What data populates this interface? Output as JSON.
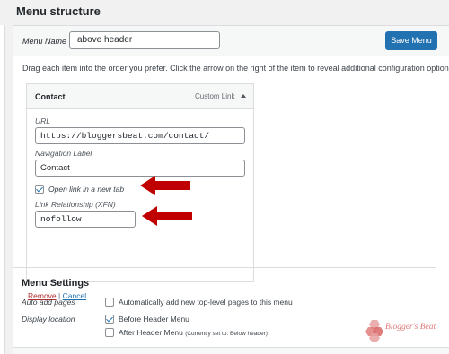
{
  "page": {
    "title": "Menu structure"
  },
  "header": {
    "menu_name_label": "Menu Name",
    "menu_name_value": "above header",
    "save_button": "Save Menu"
  },
  "instructions": "Drag each item into the order you prefer. Click the arrow on the right of the item to reveal additional configuration options.",
  "menu_item": {
    "title": "Contact",
    "type": "Custom Link",
    "url_label": "URL",
    "url_value": "https://bloggersbeat.com/contact/",
    "nav_label": "Navigation Label",
    "nav_value": "Contact",
    "new_tab_label": "Open link in a new tab",
    "new_tab_checked": true,
    "rel_label": "Link Relationship (XFN)",
    "rel_value": "nofollow",
    "remove_link": "Remove",
    "separator": "|",
    "cancel_link": "Cancel"
  },
  "settings": {
    "title": "Menu Settings",
    "auto_add_label": "Auto add pages",
    "auto_add_option": "Automatically add new top-level pages to this menu",
    "auto_add_checked": false,
    "display_location_label": "Display location",
    "locations": [
      {
        "label": "Before Header Menu",
        "checked": true,
        "note": ""
      },
      {
        "label": "After Header Menu",
        "checked": false,
        "note": "(Currently set to: Below header)"
      }
    ]
  },
  "watermark": {
    "text": "Blogger's Beat"
  },
  "colors": {
    "accent": "#2271b1",
    "arrow_red": "#c00000",
    "remove_red": "#b32d2e"
  }
}
